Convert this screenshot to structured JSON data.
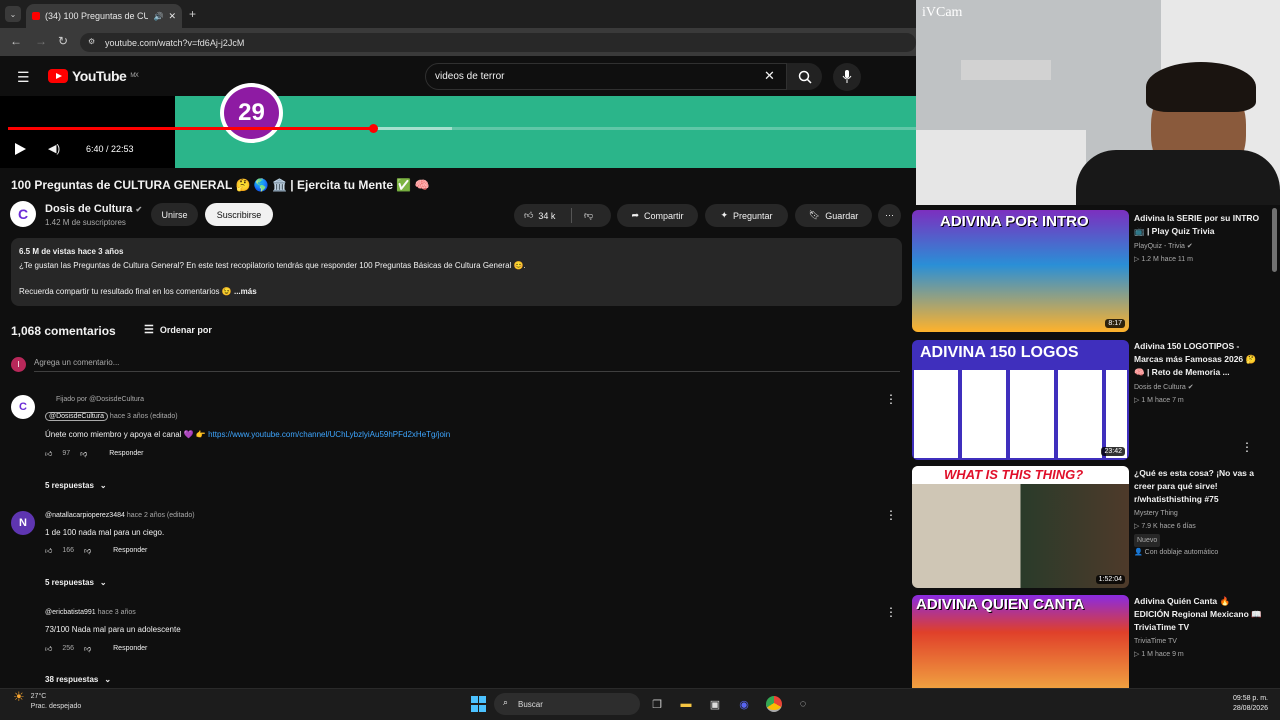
{
  "browser": {
    "tab_title": "(34) 100 Preguntas de CULT",
    "url": "youtube.com/watch?v=fd6Aj-j2JcM"
  },
  "youtube": {
    "logo_text": "YouTube",
    "region": "MX",
    "search_value": "videos de terror"
  },
  "player": {
    "question_number": "29",
    "time": "6:40 / 22:53",
    "progress": 0.291
  },
  "video": {
    "title": "100 Preguntas de CULTURA GENERAL 🤔 🌎 🏛️ | Ejercita tu Mente ✅ 🧠",
    "channel_initial": "C",
    "channel_name": "Dosis de Cultura",
    "subscribers": "1.42 M de suscriptores",
    "join_label": "Unirse",
    "subscribe_label": "Suscribirse",
    "likes": "34 k",
    "share_label": "Compartir",
    "ask_label": "Preguntar",
    "save_label": "Guardar"
  },
  "description": {
    "views_date": "6.5 M de vistas  hace 3 años",
    "line1": "¿Te gustan las Preguntas de Cultura General? En este test recopilatorio tendrás que responder 100 Preguntas Básicas de Cultura General 😊.",
    "line2": "Recuerda compartir tu resultado final en los comentarios 😉",
    "more": "...más"
  },
  "comments": {
    "count": "1,068 comentarios",
    "sort_label": "Ordenar por",
    "add_placeholder": "Agrega un comentario...",
    "user_initial": "I",
    "items": [
      {
        "pinned": "Fijado por @DosisdeCultura",
        "initial": "C",
        "handle": "@DosisdeCultura",
        "when": "hace 3 años (editado)",
        "text": "Únete como miembro y apoya el canal 💜 👉 ",
        "link": "https://www.youtube.com/channel/UChLybzlyiAu59hPFd2xHeTg/join",
        "likes": "97",
        "reply": "Responder",
        "replies": "5 respuestas"
      },
      {
        "initial": "N",
        "handle": "@natallacarpioperez3484",
        "when": "hace 2 años (editado)",
        "text": "1 de 100 nada mal para un ciego.",
        "likes": "166",
        "reply": "Responder",
        "replies": "5 respuestas"
      },
      {
        "handle": "@ericbatista991",
        "when": "hace 3 años",
        "text": "73/100 Nada mal para un adolescente",
        "likes": "256",
        "reply": "Responder",
        "replies": "38 respuestas"
      }
    ]
  },
  "webcam": {
    "label": "iVCam"
  },
  "related": [
    {
      "thumb_text": "ADIVINA POR INTRO",
      "duration": "8:17",
      "title": "Adivina la SERIE por su INTRO 📺 | Play Quiz Trivia",
      "channel": "PlayQuiz - Trivia ✔",
      "meta": "▷ 1.2 M   hace 11 m"
    },
    {
      "thumb_text": "ADIVINA 150 LOGOS",
      "duration": "23:42",
      "title": "Adivina 150 LOGOTIPOS - Marcas más Famosas 2026 🤔 🧠 | Reto de Memoria ...",
      "channel": "Dosis de Cultura ✔",
      "meta": "▷ 1 M   hace 7 m"
    },
    {
      "thumb_text": "WHAT IS THIS THING?",
      "duration": "1:52:04",
      "title": "¿Qué es esta cosa? ¡No vas a creer para qué sirve! r/whatisthisthing #75",
      "channel": "Mystery Thing",
      "meta": "▷ 7.9 K   hace 6 días",
      "badge": "Nuevo",
      "dub": "👤 Con doblaje automático"
    },
    {
      "thumb_text": "ADIVINA QUIEN CANTA",
      "title": "Adivina Quién Canta 🔥 EDICIÓN Regional Mexicano 📖 TriviaTime TV",
      "channel": "TriviaTime TV",
      "meta": "▷ 1 M   hace 9 m"
    }
  ],
  "taskbar": {
    "temp": "27°C",
    "weather": "Prac. despejado",
    "search_label": "Buscar",
    "time": "09:58 p. m.",
    "date": "28/08/2026"
  },
  "colors": {
    "accent_red": "#ff0000",
    "video_green": "#2bb58a",
    "question_purple": "#8e1ba3"
  }
}
